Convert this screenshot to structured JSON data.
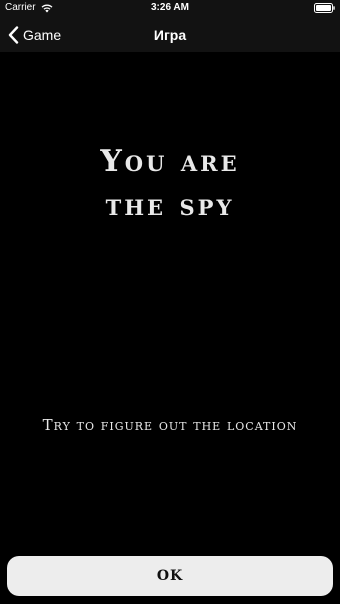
{
  "status_bar": {
    "carrier": "Carrier",
    "time": "3:26 AM",
    "wifi_icon": "wifi-icon",
    "battery_icon": "battery-icon"
  },
  "nav": {
    "back_label": "Game",
    "back_icon": "chevron-left-icon",
    "title": "Игра"
  },
  "content": {
    "headline_line1": "You are",
    "headline_line2": "the spy",
    "subtitle": "Try to figure out the location"
  },
  "ok_button": {
    "label": "OK"
  },
  "colors": {
    "background": "#000000",
    "bar_background": "#121212",
    "text": "#e8e8e8",
    "button_background": "#ededed",
    "button_text": "#111111"
  }
}
